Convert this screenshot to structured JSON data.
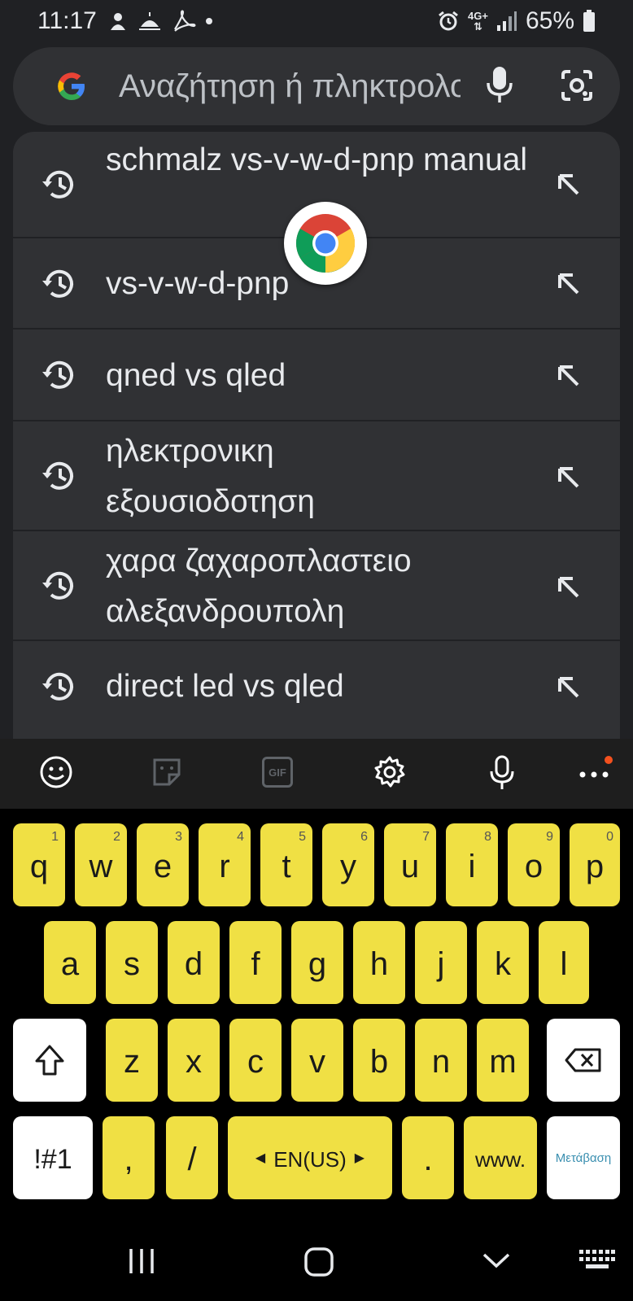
{
  "status_bar": {
    "time": "11:17",
    "network": "4G+",
    "battery": "65%"
  },
  "search": {
    "placeholder": "Αναζήτηση ή πληκτρολογήστε URL"
  },
  "suggestions": [
    {
      "text": "schmalz vs-v-w-d-pnp manual"
    },
    {
      "text": "vs-v-w-d-pnp"
    },
    {
      "text": "qned vs qled"
    },
    {
      "text": "ηλεκτρονικη εξουσιοδοτηση"
    },
    {
      "text": "χαρα ζαχαροπλαστειο αλεξανδρουπολη"
    },
    {
      "text": "direct led vs qled"
    }
  ],
  "keyboard": {
    "row1": [
      {
        "k": "q",
        "n": "1"
      },
      {
        "k": "w",
        "n": "2"
      },
      {
        "k": "e",
        "n": "3"
      },
      {
        "k": "r",
        "n": "4"
      },
      {
        "k": "t",
        "n": "5"
      },
      {
        "k": "y",
        "n": "6"
      },
      {
        "k": "u",
        "n": "7"
      },
      {
        "k": "i",
        "n": "8"
      },
      {
        "k": "o",
        "n": "9"
      },
      {
        "k": "p",
        "n": "0"
      }
    ],
    "row2": [
      "a",
      "s",
      "d",
      "f",
      "g",
      "h",
      "j",
      "k",
      "l"
    ],
    "row3": [
      "z",
      "x",
      "c",
      "v",
      "b",
      "n",
      "m"
    ],
    "symbols": "!#1",
    "comma": ",",
    "slash": "/",
    "language": "EN(US)",
    "period": ".",
    "www": "www.",
    "go": "Μετάβαση",
    "gif": "GIF"
  },
  "colors": {
    "key_yellow": "#f0e044",
    "background": "#202124",
    "surface": "#303134"
  }
}
